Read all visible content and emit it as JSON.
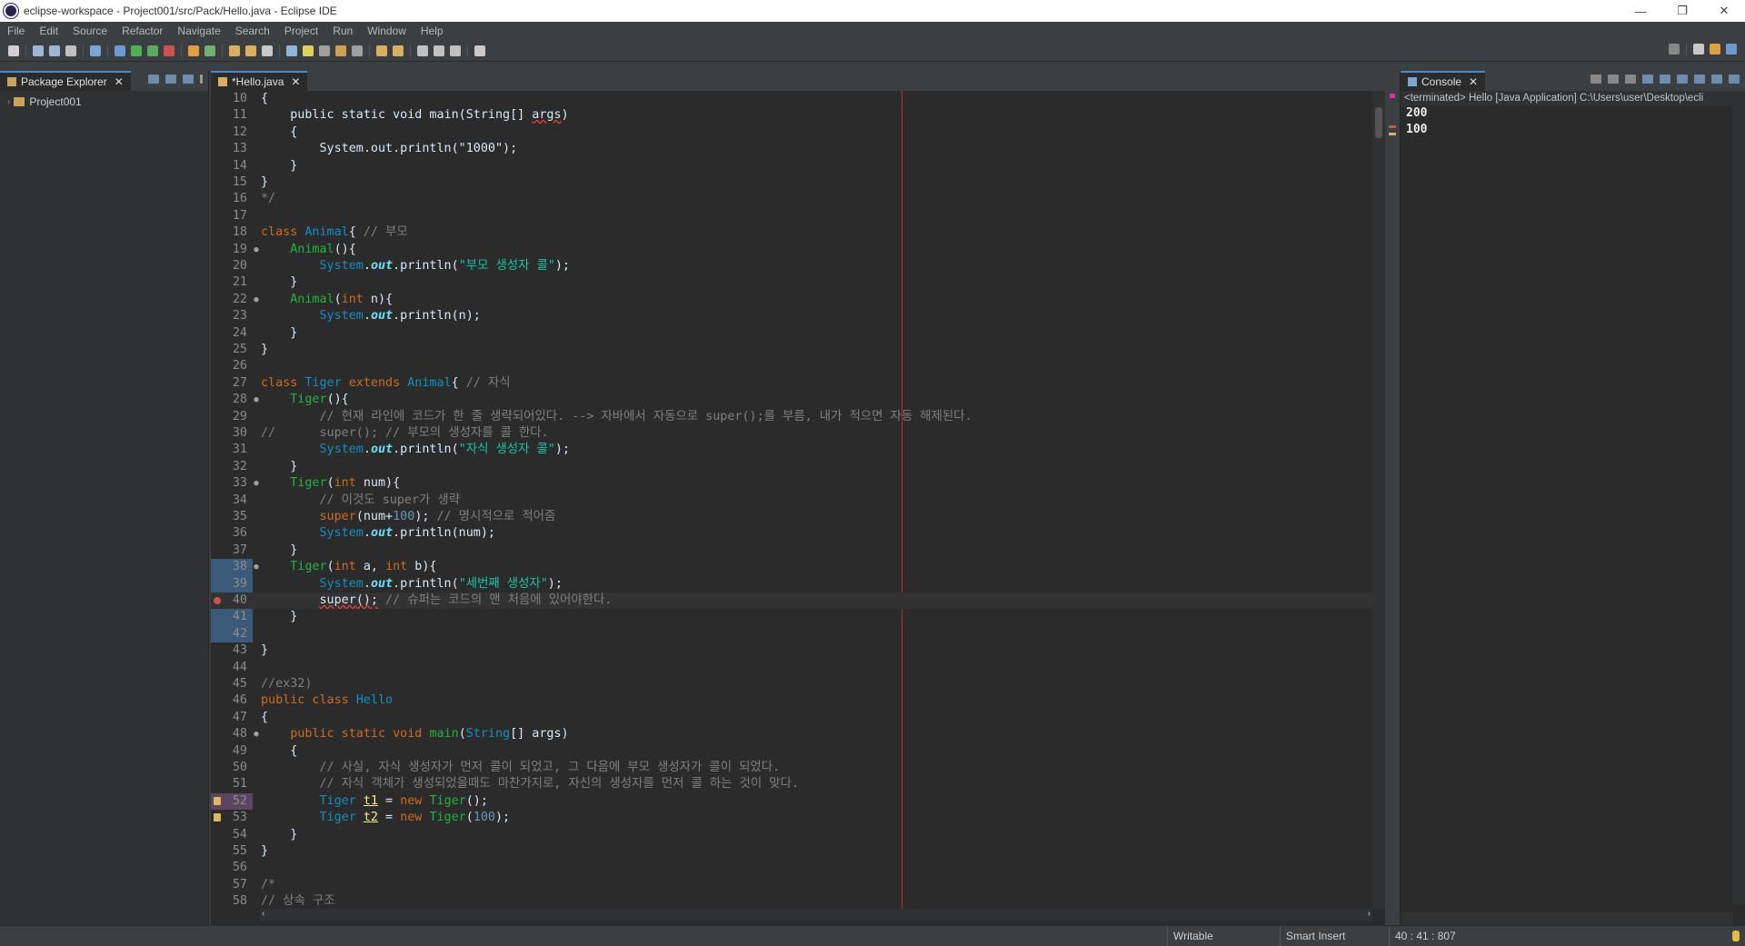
{
  "window": {
    "title": "eclipse-workspace - Project001/src/Pack/Hello.java - Eclipse IDE",
    "controls": [
      "minimize",
      "restore",
      "close"
    ]
  },
  "menu": [
    "File",
    "Edit",
    "Source",
    "Refactor",
    "Navigate",
    "Search",
    "Project",
    "Run",
    "Window",
    "Help"
  ],
  "package_explorer": {
    "tab_label": "Package Explorer",
    "tree": [
      {
        "label": "Project001"
      }
    ]
  },
  "editor": {
    "tab_label": "*Hello.java",
    "lines": [
      {
        "n": "10",
        "segs": [
          [
            "pl",
            "{"
          ]
        ]
      },
      {
        "n": "11",
        "segs": [
          [
            "pl",
            "    public static void main(String[] "
          ],
          [
            "ul",
            "args"
          ],
          [
            "pl",
            ")"
          ]
        ]
      },
      {
        "n": "12",
        "segs": [
          [
            "pl",
            "    {"
          ]
        ]
      },
      {
        "n": "13",
        "segs": [
          [
            "pl",
            "        System.out.println(\"1000\");"
          ]
        ]
      },
      {
        "n": "14",
        "segs": [
          [
            "pl",
            "    }"
          ]
        ]
      },
      {
        "n": "15",
        "segs": [
          [
            "pl",
            "}"
          ]
        ]
      },
      {
        "n": "16",
        "segs": [
          [
            "cm",
            "*/"
          ]
        ]
      },
      {
        "n": "17",
        "segs": []
      },
      {
        "n": "18",
        "segs": [
          [
            "kw",
            "class "
          ],
          [
            "ty",
            "Animal"
          ],
          [
            "pl",
            "{ "
          ],
          [
            "cm",
            "// 부모"
          ]
        ]
      },
      {
        "n": "19",
        "fold": true,
        "segs": [
          [
            "pl",
            "    "
          ],
          [
            "mt",
            "Animal"
          ],
          [
            "pl",
            "(){"
          ]
        ]
      },
      {
        "n": "20",
        "segs": [
          [
            "pl",
            "        "
          ],
          [
            "ty",
            "System"
          ],
          [
            "pl",
            "."
          ],
          [
            "fld",
            "out"
          ],
          [
            "pl",
            ".println("
          ],
          [
            "st",
            "\"부모 생성자 콜\""
          ],
          [
            "pl",
            ");"
          ]
        ]
      },
      {
        "n": "21",
        "segs": [
          [
            "pl",
            "    }"
          ]
        ]
      },
      {
        "n": "22",
        "fold": true,
        "segs": [
          [
            "pl",
            "    "
          ],
          [
            "mt",
            "Animal"
          ],
          [
            "pl",
            "("
          ],
          [
            "kw",
            "int"
          ],
          [
            "pl",
            " n){"
          ]
        ]
      },
      {
        "n": "23",
        "segs": [
          [
            "pl",
            "        "
          ],
          [
            "ty",
            "System"
          ],
          [
            "pl",
            "."
          ],
          [
            "fld",
            "out"
          ],
          [
            "pl",
            ".println(n);"
          ]
        ]
      },
      {
        "n": "24",
        "segs": [
          [
            "pl",
            "    }"
          ]
        ]
      },
      {
        "n": "25",
        "segs": [
          [
            "pl",
            "}"
          ]
        ]
      },
      {
        "n": "26",
        "segs": []
      },
      {
        "n": "27",
        "segs": [
          [
            "kw",
            "class "
          ],
          [
            "ty",
            "Tiger "
          ],
          [
            "kw",
            "extends "
          ],
          [
            "ty",
            "Animal"
          ],
          [
            "pl",
            "{ "
          ],
          [
            "cm",
            "// 자식"
          ]
        ]
      },
      {
        "n": "28",
        "fold": true,
        "segs": [
          [
            "pl",
            "    "
          ],
          [
            "mt",
            "Tiger"
          ],
          [
            "pl",
            "(){"
          ]
        ]
      },
      {
        "n": "29",
        "segs": [
          [
            "cm",
            "        // 현재 라인에 코드가 한 줄 생략되어있다. --> 자바에서 자동으로 super();를 부름, 내가 적으면 자동 해제된다."
          ]
        ]
      },
      {
        "n": "30",
        "segs": [
          [
            "cm",
            "//      super(); // 부모의 생성자를 콜 한다."
          ]
        ]
      },
      {
        "n": "31",
        "segs": [
          [
            "pl",
            "        "
          ],
          [
            "ty",
            "System"
          ],
          [
            "pl",
            "."
          ],
          [
            "fld",
            "out"
          ],
          [
            "pl",
            ".println("
          ],
          [
            "st",
            "\"자식 생성자 콜\""
          ],
          [
            "pl",
            ");"
          ]
        ]
      },
      {
        "n": "32",
        "segs": [
          [
            "pl",
            "    }"
          ]
        ]
      },
      {
        "n": "33",
        "fold": true,
        "segs": [
          [
            "pl",
            "    "
          ],
          [
            "mt",
            "Tiger"
          ],
          [
            "pl",
            "("
          ],
          [
            "kw",
            "int"
          ],
          [
            "pl",
            " num){"
          ]
        ]
      },
      {
        "n": "34",
        "segs": [
          [
            "cm",
            "        // 이것도 super가 생략"
          ]
        ]
      },
      {
        "n": "35",
        "segs": [
          [
            "pl",
            "        "
          ],
          [
            "kw",
            "super"
          ],
          [
            "pl",
            "(num+"
          ],
          [
            "nm",
            "100"
          ],
          [
            "pl",
            "); "
          ],
          [
            "cm",
            "// 명시적으로 적어줌"
          ]
        ]
      },
      {
        "n": "36",
        "segs": [
          [
            "pl",
            "        "
          ],
          [
            "ty",
            "System"
          ],
          [
            "pl",
            "."
          ],
          [
            "fld",
            "out"
          ],
          [
            "pl",
            ".println(num);"
          ]
        ]
      },
      {
        "n": "37",
        "segs": [
          [
            "pl",
            "    }"
          ]
        ]
      },
      {
        "n": "38",
        "fold": true,
        "hl": true,
        "segs": [
          [
            "pl",
            "    "
          ],
          [
            "mt",
            "Tiger"
          ],
          [
            "pl",
            "("
          ],
          [
            "kw",
            "int"
          ],
          [
            "pl",
            " a, "
          ],
          [
            "kw",
            "int"
          ],
          [
            "pl",
            " b){"
          ]
        ]
      },
      {
        "n": "39",
        "hl": true,
        "segs": [
          [
            "pl",
            "        "
          ],
          [
            "ty",
            "System"
          ],
          [
            "pl",
            "."
          ],
          [
            "fld",
            "out"
          ],
          [
            "pl",
            ".println("
          ],
          [
            "st",
            "\"세번째 생성자\""
          ],
          [
            "pl",
            ");"
          ]
        ]
      },
      {
        "n": "40",
        "hl": true,
        "err": true,
        "current": true,
        "segs": [
          [
            "pl",
            "        "
          ],
          [
            "err",
            "super"
          ],
          [
            "err",
            "();"
          ],
          [
            "cm",
            " // 슈퍼는 코드의 맨 처음에 있어야한다."
          ]
        ]
      },
      {
        "n": "41",
        "hl": true,
        "segs": [
          [
            "pl",
            "    }"
          ]
        ]
      },
      {
        "n": "42",
        "hl": true,
        "segs": []
      },
      {
        "n": "43",
        "segs": [
          [
            "pl",
            "}"
          ]
        ]
      },
      {
        "n": "44",
        "segs": []
      },
      {
        "n": "45",
        "segs": [
          [
            "cm",
            "//ex32)"
          ]
        ]
      },
      {
        "n": "46",
        "segs": [
          [
            "kw",
            "public class "
          ],
          [
            "ty",
            "Hello"
          ]
        ]
      },
      {
        "n": "47",
        "segs": [
          [
            "pl",
            "{"
          ]
        ]
      },
      {
        "n": "48",
        "fold": true,
        "segs": [
          [
            "pl",
            "    "
          ],
          [
            "kw",
            "public static void "
          ],
          [
            "mt",
            "main"
          ],
          [
            "pl",
            "("
          ],
          [
            "ty",
            "String"
          ],
          [
            "pl",
            "[] args)"
          ]
        ]
      },
      {
        "n": "49",
        "segs": [
          [
            "pl",
            "    {"
          ]
        ]
      },
      {
        "n": "50",
        "segs": [
          [
            "cm",
            "        // 사실, 자식 생성자가 먼저 콜이 되었고, 그 다음에 부모 생성자가 콜이 되었다."
          ]
        ]
      },
      {
        "n": "51",
        "segs": [
          [
            "cm",
            "        // 자식 객체가 생성되었을때도 마찬가지로, 자신의 생성자를 먼저 콜 하는 것이 맞다."
          ]
        ]
      },
      {
        "n": "52",
        "warn": true,
        "hl2": true,
        "segs": [
          [
            "pl",
            "        "
          ],
          [
            "ty",
            "Tiger "
          ],
          [
            "uv",
            "t1"
          ],
          [
            "pl",
            " = "
          ],
          [
            "kw",
            "new "
          ],
          [
            "mt",
            "Tiger"
          ],
          [
            "pl",
            "();"
          ]
        ]
      },
      {
        "n": "53",
        "warn": true,
        "segs": [
          [
            "pl",
            "        "
          ],
          [
            "ty",
            "Tiger "
          ],
          [
            "uv",
            "t2"
          ],
          [
            "pl",
            " = "
          ],
          [
            "kw",
            "new "
          ],
          [
            "mt",
            "Tiger"
          ],
          [
            "pl",
            "("
          ],
          [
            "nm",
            "100"
          ],
          [
            "pl",
            ");"
          ]
        ]
      },
      {
        "n": "54",
        "segs": [
          [
            "pl",
            "    }"
          ]
        ]
      },
      {
        "n": "55",
        "segs": [
          [
            "pl",
            "}"
          ]
        ]
      },
      {
        "n": "56",
        "segs": []
      },
      {
        "n": "57",
        "segs": [
          [
            "cm",
            "/*"
          ]
        ]
      },
      {
        "n": "58",
        "segs": [
          [
            "cm",
            "// 상속 구조"
          ]
        ]
      }
    ]
  },
  "console": {
    "tab_label": "Console",
    "header": "<terminated> Hello [Java Application] C:\\Users\\user\\Desktop\\ecli",
    "output": [
      "200",
      "100"
    ]
  },
  "status": {
    "writable": "Writable",
    "insert_mode": "Smart Insert",
    "position": "40 : 41 : 807"
  },
  "colors": {
    "background": "#2b2b2b",
    "chrome": "#3c3f41",
    "keyword": "#cc6c1d",
    "type": "#1290c3",
    "string": "#17c6a3",
    "comment": "#808080",
    "error": "#c75450"
  }
}
